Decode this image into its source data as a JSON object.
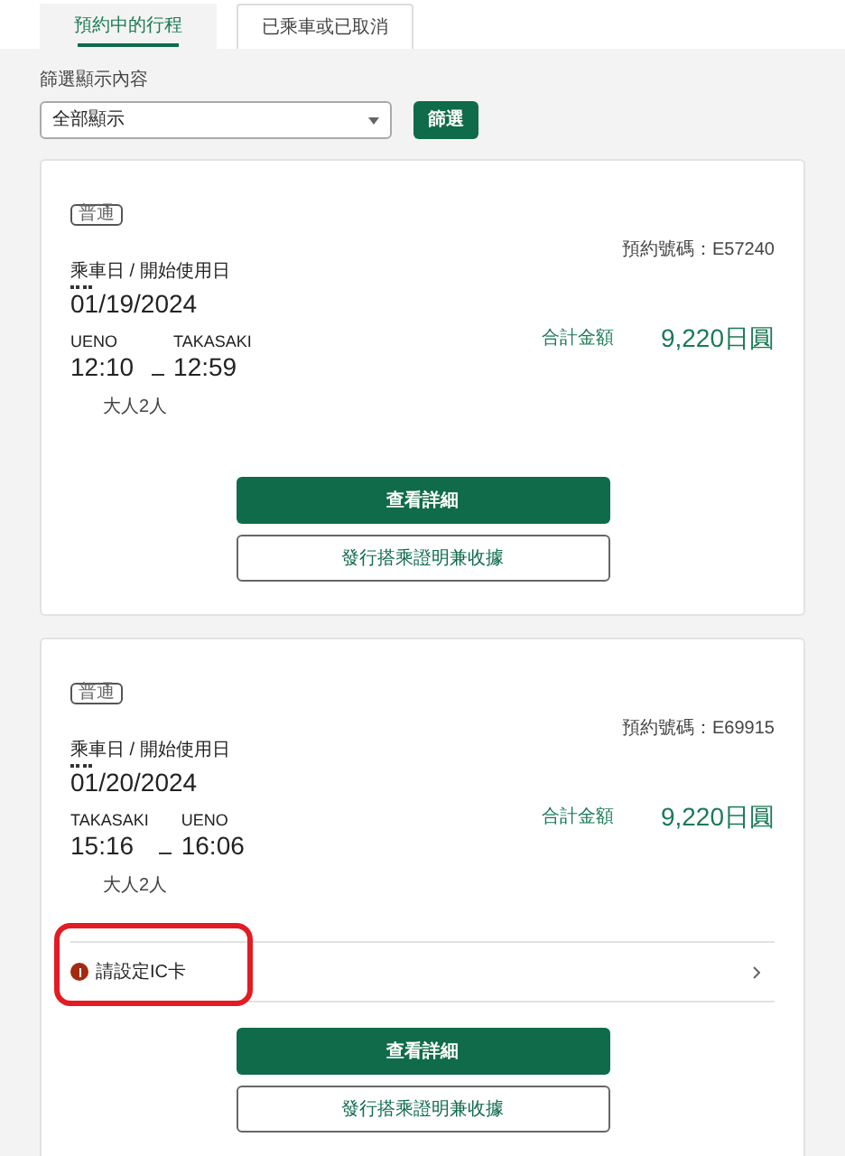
{
  "tabs": [
    {
      "label": "預約中的行程",
      "selected": true
    },
    {
      "label": "已乘車或已取消",
      "selected": false
    }
  ],
  "filter": {
    "label": "篩選顯示內容",
    "value": "全部顯示",
    "button": "篩選"
  },
  "reservations": [
    {
      "badge": "普通",
      "reservation_no": "預約號碼：E57240",
      "date_label": "乘車日 / 開始使用日",
      "date": "01/19/2024",
      "from": "UENO",
      "to": "TAKASAKI",
      "depart": "12:10",
      "arrive": "12:59",
      "passengers": "大人2人",
      "total_label": "合計金額",
      "total": "9,220日圓",
      "detail_button": "查看詳細",
      "receipt_button": "發行搭乘證明兼收據"
    },
    {
      "badge": "普通",
      "reservation_no": "預約號碼：E69915",
      "date_label": "乘車日 / 開始使用日",
      "date": "01/20/2024",
      "from": "TAKASAKI",
      "to": "UENO",
      "depart": "15:16",
      "arrive": "16:06",
      "passengers": "大人2人",
      "total_label": "合計金額",
      "total": "9,220日圓",
      "alert": {
        "text": "請設定IC卡",
        "highlighted": true
      },
      "detail_button": "查看詳細",
      "receipt_button": "發行搭乘證明兼收據"
    }
  ]
}
